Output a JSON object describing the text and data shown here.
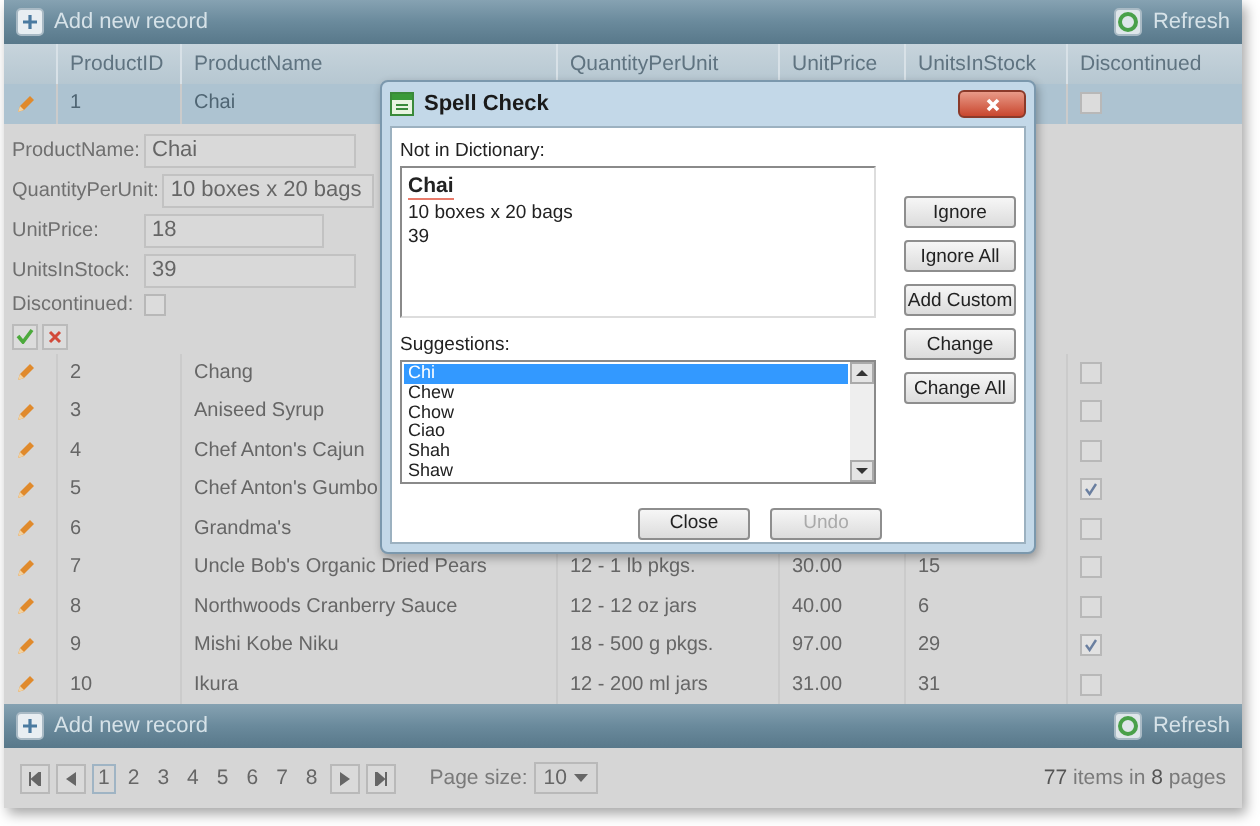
{
  "toolbar_top": {
    "add_label": "Add new record",
    "refresh_label": "Refresh"
  },
  "table": {
    "columns": [
      "ProductID",
      "ProductName",
      "QuantityPerUnit",
      "UnitPrice",
      "UnitsInStock",
      "Discontinued"
    ],
    "rows": [
      {
        "id": "1",
        "name": "Chai",
        "discontinued": false,
        "selected": true
      },
      {
        "id": "2",
        "name": "Chang",
        "discontinued": false,
        "selected": false
      },
      {
        "id": "3",
        "name": "Aniseed Syrup",
        "discontinued": false,
        "selected": false
      },
      {
        "id": "4",
        "name": "Chef Anton's Cajun",
        "discontinued": false,
        "selected": false
      },
      {
        "id": "5",
        "name": "Chef Anton's Gumbo",
        "discontinued": true,
        "selected": false
      },
      {
        "id": "6",
        "name": "Grandma's",
        "discontinued": false,
        "selected": false
      },
      {
        "id": "7",
        "name": "Uncle Bob's Organic Dried Pears",
        "quantity": "12 - 1 lb pkgs.",
        "price": "30.00",
        "stock": "15",
        "discontinued": false,
        "selected": false
      },
      {
        "id": "8",
        "name": "Northwoods Cranberry Sauce",
        "quantity": "12 - 12 oz jars",
        "price": "40.00",
        "stock": "6",
        "discontinued": false,
        "selected": false
      },
      {
        "id": "9",
        "name": "Mishi Kobe Niku",
        "quantity": "18 - 500 g pkgs.",
        "price": "97.00",
        "stock": "29",
        "discontinued": true,
        "selected": false
      },
      {
        "id": "10",
        "name": "Ikura",
        "quantity": "12 - 200 ml jars",
        "price": "31.00",
        "stock": "31",
        "discontinued": false,
        "selected": false
      }
    ]
  },
  "edit_form": {
    "fields": [
      {
        "label": "ProductName:",
        "value": "Chai",
        "kind": "text"
      },
      {
        "label": "QuantityPerUnit:",
        "value": "10 boxes x 20 bags",
        "kind": "text"
      },
      {
        "label": "UnitPrice:",
        "value": "18",
        "kind": "number"
      },
      {
        "label": "UnitsInStock:",
        "value": "39",
        "kind": "text"
      },
      {
        "label": "Discontinued:",
        "kind": "checkbox",
        "checked": false
      }
    ]
  },
  "toolbar_bottom": {
    "add_label": "Add new record",
    "refresh_label": "Refresh"
  },
  "pager": {
    "pages": [
      {
        "label": "1",
        "selected": true
      },
      {
        "label": "2",
        "selected": false
      },
      {
        "label": "3",
        "selected": false
      },
      {
        "label": "4",
        "selected": false
      },
      {
        "label": "5",
        "selected": false
      },
      {
        "label": "6",
        "selected": false
      },
      {
        "label": "7",
        "selected": false
      },
      {
        "label": "8",
        "selected": false
      }
    ],
    "page_size_label": "Page size:",
    "page_size": "10",
    "summary": "**77** items in **8** pages"
  },
  "dialog": {
    "title": "Spell Check",
    "not_in_dictionary_label": "Not in Dictionary:",
    "text_lines": [
      {
        "text": "Chai",
        "misspelled": true
      },
      {
        "text": "10 boxes x 20 bags",
        "misspelled": false
      },
      {
        "text": "39",
        "misspelled": false
      }
    ],
    "suggestions_label": "Suggestions:",
    "suggestions": [
      {
        "label": "Chi",
        "selected": true
      },
      {
        "label": "Chew",
        "selected": false
      },
      {
        "label": "Chow",
        "selected": false
      },
      {
        "label": "Ciao",
        "selected": false
      },
      {
        "label": "Shah",
        "selected": false
      },
      {
        "label": "Shaw",
        "selected": false
      }
    ],
    "side_buttons": [
      "Ignore",
      "Ignore All",
      "Add Custom",
      "Change",
      "Change All"
    ],
    "footer_buttons": [
      {
        "label": "Close",
        "disabled": false
      },
      {
        "label": "Undo",
        "disabled": true
      }
    ]
  }
}
